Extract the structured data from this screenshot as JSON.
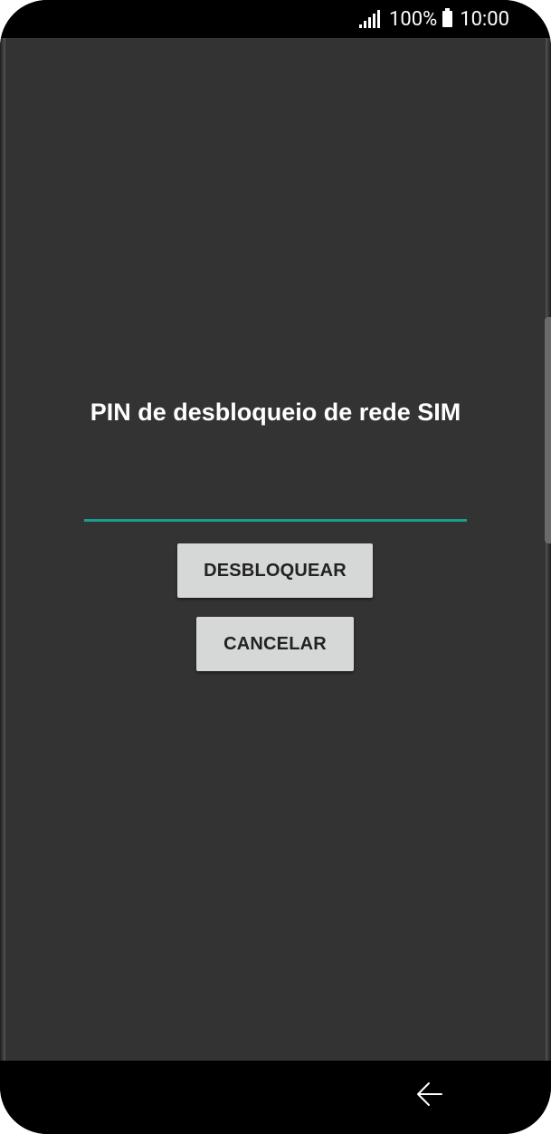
{
  "status_bar": {
    "battery_percent": "100%",
    "time": "10:00",
    "signal_icon": "signal-icon",
    "battery_icon": "battery-icon"
  },
  "dialog": {
    "title": "PIN de desbloqueio de rede SIM",
    "pin_value": "",
    "unlock_label": "DESBLOQUEAR",
    "cancel_label": "CANCELAR"
  },
  "nav_bar": {
    "back_icon": "back-icon"
  },
  "colors": {
    "screen_background": "#333333",
    "input_underline": "#1a9e8f",
    "button_background": "#d6d7d7"
  }
}
